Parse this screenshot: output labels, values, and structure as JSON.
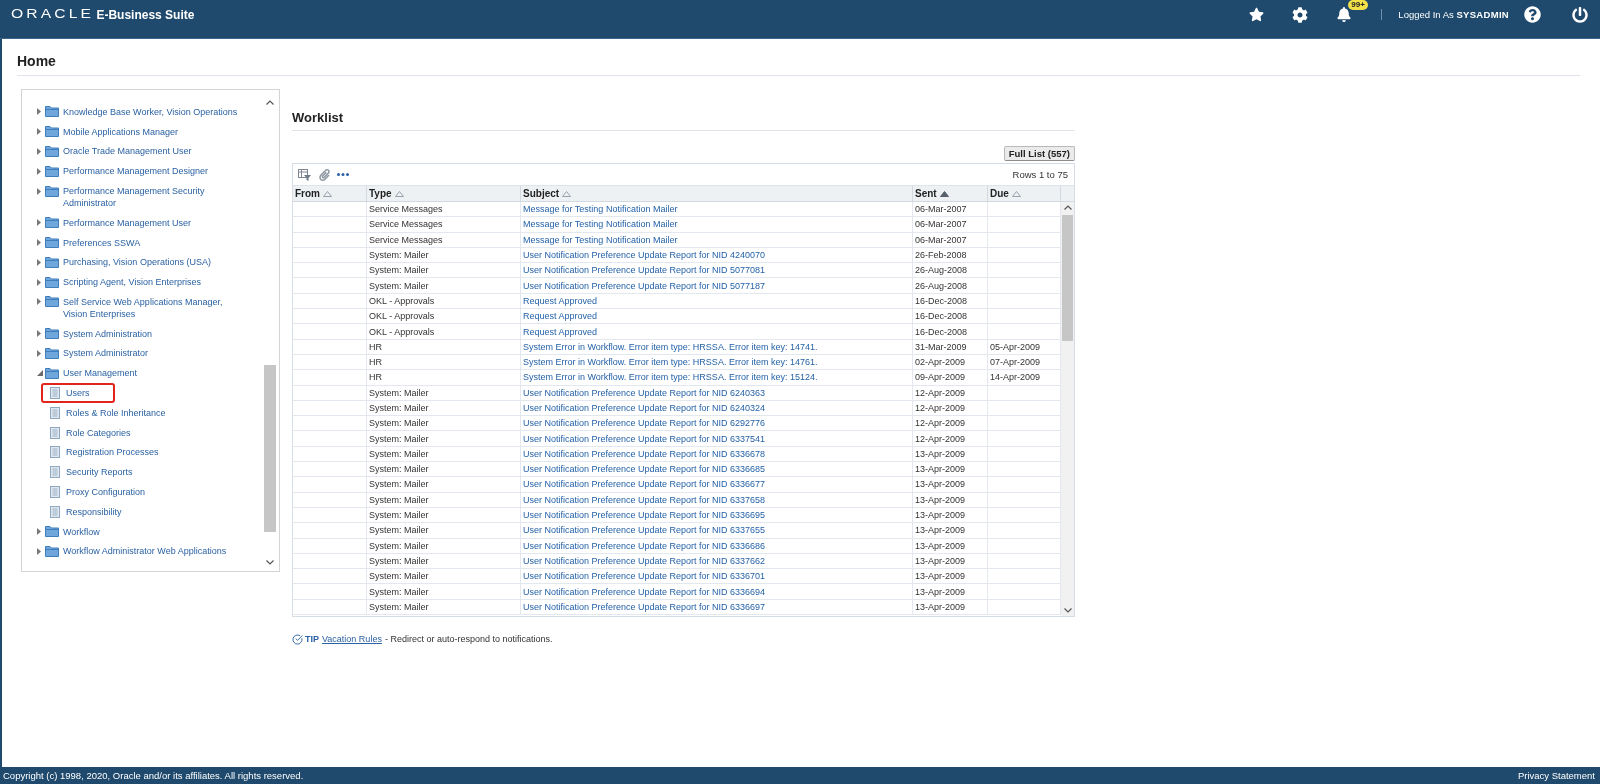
{
  "header": {
    "logo": "ORACLE",
    "product": "E-Business Suite",
    "notification_count": "99+",
    "user": "Logged In As **SYSADMIN**"
  },
  "page": {
    "title": "Home"
  },
  "navigator": {
    "items": [
      {
        "kind": "folder",
        "label": "Knowledge Base Worker, Vision Operations",
        "expanded": false
      },
      {
        "kind": "folder",
        "label": "Mobile Applications Manager",
        "expanded": false
      },
      {
        "kind": "folder",
        "label": "Oracle Trade Management User",
        "expanded": false
      },
      {
        "kind": "folder",
        "label": "Performance Management Designer",
        "expanded": false
      },
      {
        "kind": "folder",
        "label": "Performance Management Security Administrator",
        "expanded": false
      },
      {
        "kind": "folder",
        "label": "Performance Management User",
        "expanded": false
      },
      {
        "kind": "folder",
        "label": "Preferences SSWA",
        "expanded": false
      },
      {
        "kind": "folder",
        "label": "Purchasing, Vision Operations (USA)",
        "expanded": false
      },
      {
        "kind": "folder",
        "label": "Scripting Agent, Vision Enterprises",
        "expanded": false
      },
      {
        "kind": "folder",
        "label": "Self Service Web Applications Manager, Vision Enterprises",
        "expanded": false
      },
      {
        "kind": "folder",
        "label": "System Administration",
        "expanded": false
      },
      {
        "kind": "folder",
        "label": "System Administrator",
        "expanded": false
      },
      {
        "kind": "folder",
        "label": "User Management",
        "expanded": true,
        "children": [
          {
            "kind": "page",
            "label": "Users",
            "highlighted": true
          },
          {
            "kind": "page",
            "label": "Roles & Role Inheritance",
            "highlighted": false
          },
          {
            "kind": "page",
            "label": "Role Categories",
            "highlighted": false
          },
          {
            "kind": "page",
            "label": "Registration Processes",
            "highlighted": false
          },
          {
            "kind": "page",
            "label": "Security Reports",
            "highlighted": false
          },
          {
            "kind": "page",
            "label": "Proxy Configuration",
            "highlighted": false
          },
          {
            "kind": "page",
            "label": "Responsibility",
            "highlighted": false
          }
        ]
      },
      {
        "kind": "folder",
        "label": "Workflow",
        "expanded": false
      },
      {
        "kind": "folder",
        "label": "Workflow Administrator Web Applications",
        "expanded": false
      }
    ]
  },
  "worklist": {
    "title": "Worklist",
    "full_list_button": "Full List (557)",
    "row_range": "Rows 1 to 75",
    "columns": [
      {
        "label": "From",
        "sorted": false
      },
      {
        "label": "Type",
        "sorted": false
      },
      {
        "label": "Subject",
        "sorted": false
      },
      {
        "label": "Sent",
        "sorted": true
      },
      {
        "label": "Due",
        "sorted": false
      }
    ],
    "rows": [
      {
        "type": "Service Messages",
        "subject": "Message for Testing Notification Mailer",
        "sent": "06-Mar-2007"
      },
      {
        "type": "Service Messages",
        "subject": "Message for Testing Notification Mailer",
        "sent": "06-Mar-2007"
      },
      {
        "type": "Service Messages",
        "subject": "Message for Testing Notification Mailer",
        "sent": "06-Mar-2007"
      },
      {
        "type": "System: Mailer",
        "subject": "User Notification Preference Update Report for NID 4240070",
        "sent": "26-Feb-2008"
      },
      {
        "type": "System: Mailer",
        "subject": "User Notification Preference Update Report for NID 5077081",
        "sent": "26-Aug-2008"
      },
      {
        "type": "System: Mailer",
        "subject": "User Notification Preference Update Report for NID 5077187",
        "sent": "26-Aug-2008"
      },
      {
        "type": "OKL - Approvals",
        "subject": "Request Approved",
        "sent": "16-Dec-2008"
      },
      {
        "type": "OKL - Approvals",
        "subject": "Request Approved",
        "sent": "16-Dec-2008"
      },
      {
        "type": "OKL - Approvals",
        "subject": "Request Approved",
        "sent": "16-Dec-2008"
      },
      {
        "type": "HR",
        "subject": "System Error in Workflow. Error item type: HRSSA. Error item key: 14741.",
        "sent": "31-Mar-2009",
        "due": "05-Apr-2009"
      },
      {
        "type": "HR",
        "subject": "System Error in Workflow. Error item type: HRSSA. Error item key: 14761.",
        "sent": "02-Apr-2009",
        "due": "07-Apr-2009"
      },
      {
        "type": "HR",
        "subject": "System Error in Workflow. Error item type: HRSSA. Error item key: 15124.",
        "sent": "09-Apr-2009",
        "due": "14-Apr-2009"
      },
      {
        "type": "System: Mailer",
        "subject": "User Notification Preference Update Report for NID 6240363",
        "sent": "12-Apr-2009"
      },
      {
        "type": "System: Mailer",
        "subject": "User Notification Preference Update Report for NID 6240324",
        "sent": "12-Apr-2009"
      },
      {
        "type": "System: Mailer",
        "subject": "User Notification Preference Update Report for NID 6292776",
        "sent": "12-Apr-2009"
      },
      {
        "type": "System: Mailer",
        "subject": "User Notification Preference Update Report for NID 6337541",
        "sent": "12-Apr-2009"
      },
      {
        "type": "System: Mailer",
        "subject": "User Notification Preference Update Report for NID 6336678",
        "sent": "13-Apr-2009"
      },
      {
        "type": "System: Mailer",
        "subject": "User Notification Preference Update Report for NID 6336685",
        "sent": "13-Apr-2009"
      },
      {
        "type": "System: Mailer",
        "subject": "User Notification Preference Update Report for NID 6336677",
        "sent": "13-Apr-2009"
      },
      {
        "type": "System: Mailer",
        "subject": "User Notification Preference Update Report for NID 6337658",
        "sent": "13-Apr-2009"
      },
      {
        "type": "System: Mailer",
        "subject": "User Notification Preference Update Report for NID 6336695",
        "sent": "13-Apr-2009"
      },
      {
        "type": "System: Mailer",
        "subject": "User Notification Preference Update Report for NID 6337655",
        "sent": "13-Apr-2009"
      },
      {
        "type": "System: Mailer",
        "subject": "User Notification Preference Update Report for NID 6336686",
        "sent": "13-Apr-2009"
      },
      {
        "type": "System: Mailer",
        "subject": "User Notification Preference Update Report for NID 6337662",
        "sent": "13-Apr-2009"
      },
      {
        "type": "System: Mailer",
        "subject": "User Notification Preference Update Report for NID 6336701",
        "sent": "13-Apr-2009"
      },
      {
        "type": "System: Mailer",
        "subject": "User Notification Preference Update Report for NID 6336694",
        "sent": "13-Apr-2009"
      },
      {
        "type": "System: Mailer",
        "subject": "User Notification Preference Update Report for NID 6336697",
        "sent": "13-Apr-2009"
      }
    ]
  },
  "tip": {
    "label": "TIP",
    "link": "Vacation Rules",
    "text": "- Redirect or auto-respond to notifications."
  },
  "footer": {
    "copyright": "Copyright (c) 1998, 2020, Oracle and/or its affiliates. All rights reserved.",
    "privacy_link": "Privacy Statement"
  }
}
